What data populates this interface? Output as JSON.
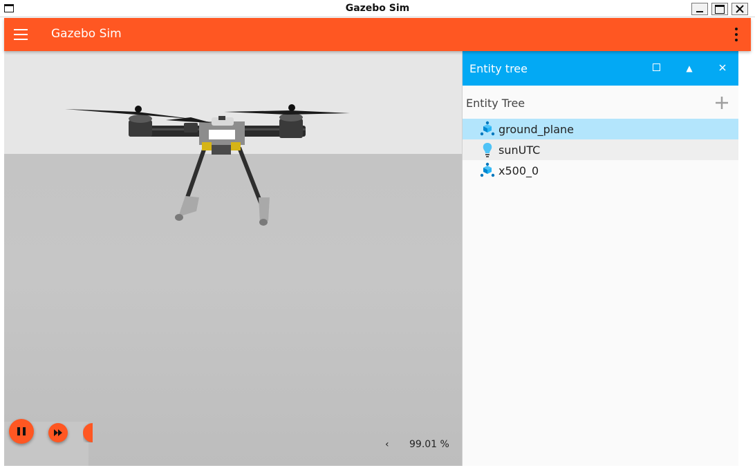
{
  "window": {
    "title": "Gazebo Sim"
  },
  "appbar": {
    "title": "Gazebo Sim",
    "menu_icon": "hamburger-menu-icon",
    "overflow_icon": "more-vert-icon",
    "color": "#ff5722"
  },
  "viewport": {
    "controls": {
      "play_icon": "pause-icon",
      "step_icon": "fast-forward-icon"
    },
    "stats_toggle": "‹",
    "real_time_factor": "99.01 %"
  },
  "entity_panel": {
    "header_title": "Entity tree",
    "header_color": "#03a9f4",
    "heading": "Entity Tree",
    "add_icon": "plus-icon",
    "entities": [
      {
        "label": "ground_plane",
        "icon": "model-icon",
        "selected": true
      },
      {
        "label": "sunUTC",
        "icon": "light-bulb-icon",
        "selected": false
      },
      {
        "label": "x500_0",
        "icon": "model-icon",
        "selected": false
      }
    ]
  }
}
